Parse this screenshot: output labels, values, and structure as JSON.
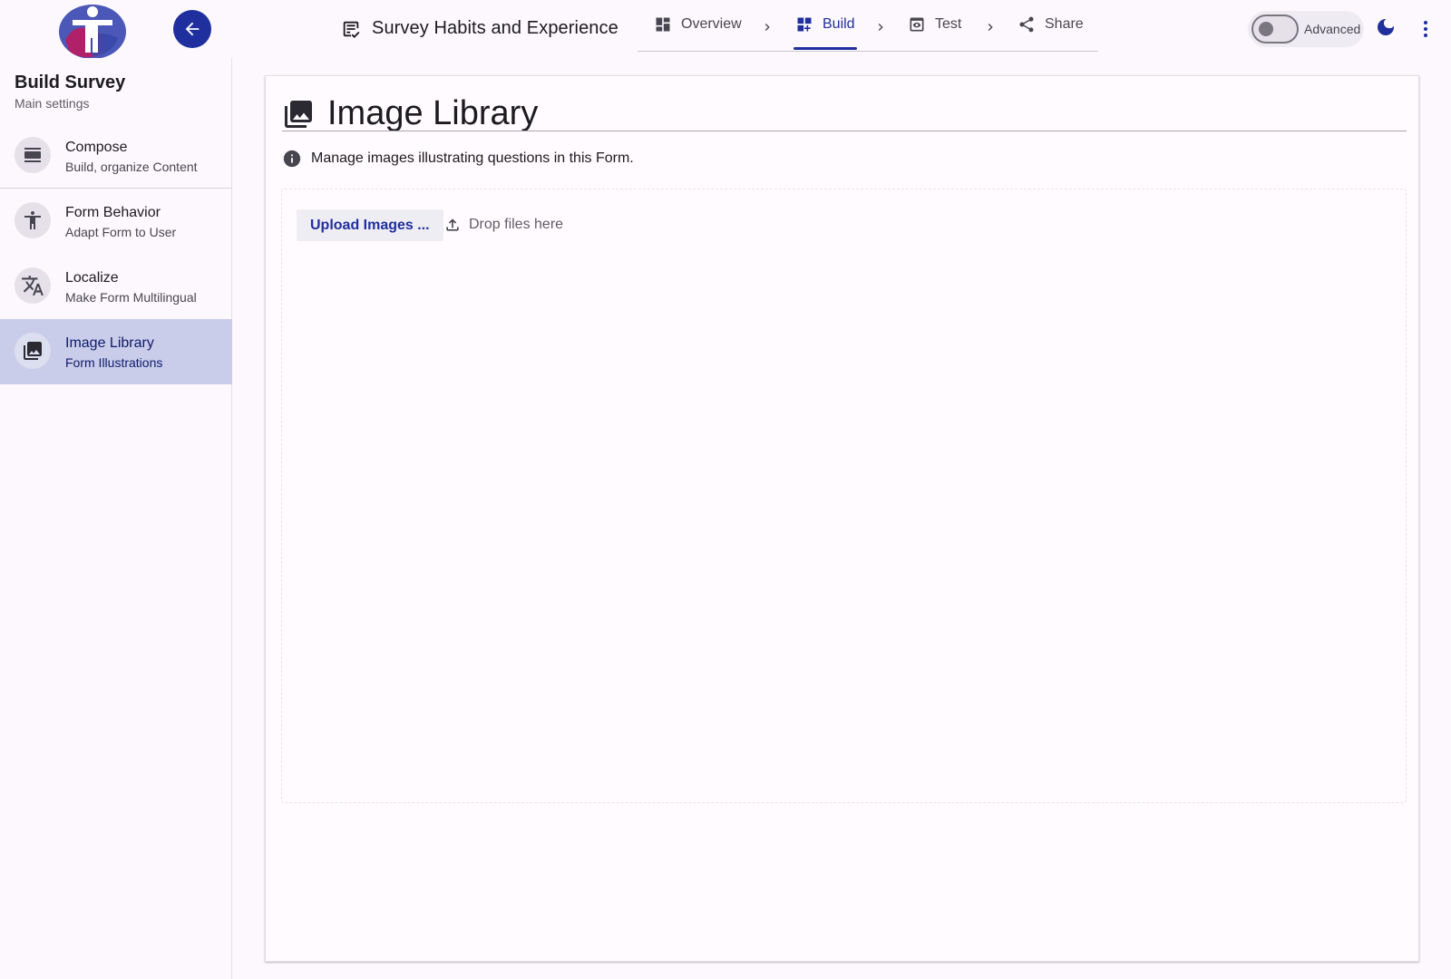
{
  "header": {
    "survey_title": "Survey Habits and Experience",
    "steps": [
      {
        "label": "Overview",
        "icon": "dashboard-icon",
        "active": false
      },
      {
        "label": "Build",
        "icon": "dashboard-add-icon",
        "active": true
      },
      {
        "label": "Test",
        "icon": "preview-icon",
        "active": false
      },
      {
        "label": "Share",
        "icon": "share-icon",
        "active": false
      }
    ],
    "advanced_label": "Advanced",
    "advanced_enabled": false
  },
  "sidebar": {
    "title": "Build Survey",
    "subtitle": "Main settings",
    "items": [
      {
        "label": "Compose",
        "description": "Build, organize Content",
        "icon": "compose-icon",
        "selected": false
      },
      {
        "label": "Form Behavior",
        "description": "Adapt Form to User",
        "icon": "accessibility-icon",
        "selected": false
      },
      {
        "label": "Localize",
        "description": "Make Form Multilingual",
        "icon": "translate-icon",
        "selected": false
      },
      {
        "label": "Image Library",
        "description": "Form Illustrations",
        "icon": "photo-library-icon",
        "selected": true
      }
    ]
  },
  "main": {
    "title": "Image Library",
    "info_text": "Manage images illustrating questions in this Form.",
    "upload_button": "Upload Images ...",
    "drop_hint": "Drop files here"
  },
  "colors": {
    "primary": "#1f2f9e",
    "background": "#fdf8fd",
    "selected_item": "#c9cdea"
  }
}
